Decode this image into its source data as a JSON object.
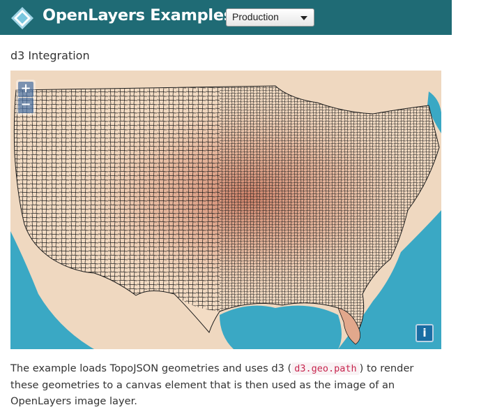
{
  "header": {
    "brand": "OpenLayers Examples",
    "version_select": "Production"
  },
  "example": {
    "title": "d3 Integration",
    "desc_before": "The example loads TopoJSON geometries and uses d3 (",
    "desc_code": "d3.geo.path",
    "desc_after": ") to render these geometries to a canvas element that is then used as the image of an OpenLayers image layer."
  },
  "map": {
    "zoom_in": "+",
    "zoom_out": "−",
    "attribution_button": "i",
    "colors": {
      "water": "#3aa8c4",
      "land": "#f0d6bc",
      "heat": "#c9735a",
      "county_lines": "#1a1a1a"
    }
  }
}
